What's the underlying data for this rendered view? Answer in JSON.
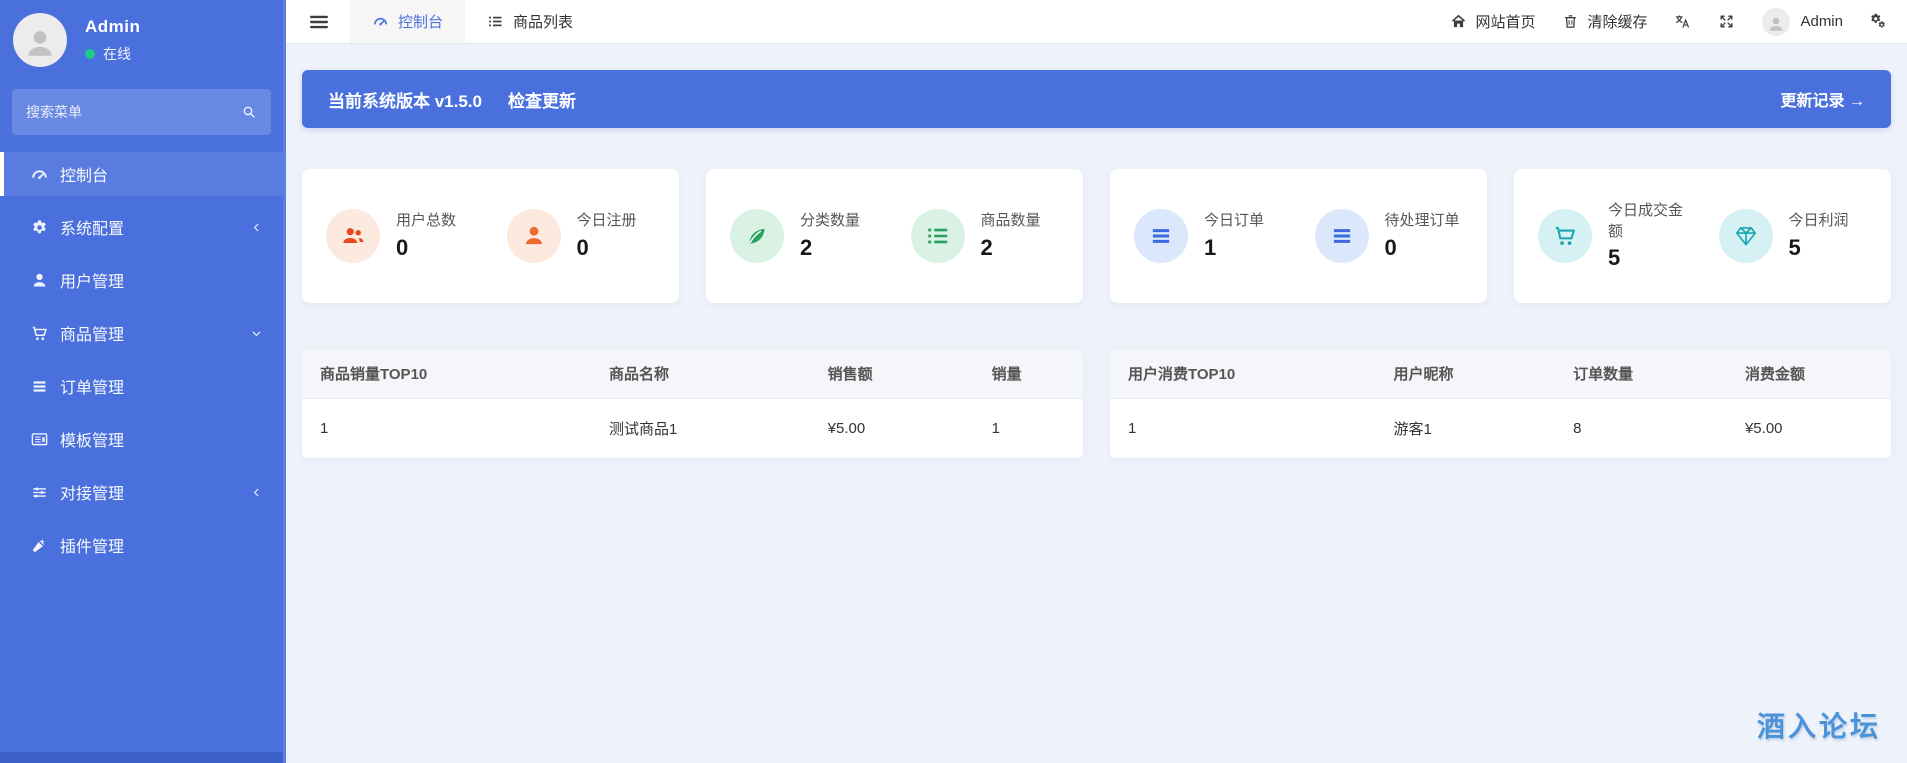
{
  "colors": {
    "accent_blue": "#4a70dd",
    "online_green": "#1ec98b",
    "watermark_blue": "#4b93d8"
  },
  "sidebar": {
    "user_name": "Admin",
    "user_status": "在线",
    "avatar_icon": "person-icon",
    "search_placeholder": "搜索菜单",
    "search_icon": "search-icon",
    "items": [
      {
        "label": "控制台",
        "icon": "gauge-icon",
        "chevron": ""
      },
      {
        "label": "系统配置",
        "icon": "gear-icon",
        "chevron": "chevron-left-icon"
      },
      {
        "label": "用户管理",
        "icon": "user-icon",
        "chevron": ""
      },
      {
        "label": "商品管理",
        "icon": "cart-icon",
        "chevron": "chevron-down-icon"
      },
      {
        "label": "订单管理",
        "icon": "bars-icon",
        "chevron": ""
      },
      {
        "label": "模板管理",
        "icon": "template-icon",
        "chevron": ""
      },
      {
        "label": "对接管理",
        "icon": "sliders-icon",
        "chevron": "chevron-left-icon"
      },
      {
        "label": "插件管理",
        "icon": "plug-icon",
        "chevron": ""
      }
    ]
  },
  "topbar": {
    "menu_icon": "menu-icon",
    "tabs": [
      {
        "label": "控制台",
        "icon": "gauge-icon"
      },
      {
        "label": "商品列表",
        "icon": "list-icon"
      }
    ],
    "home_icon": "home-icon",
    "home_label": "网站首页",
    "trash_icon": "trash-icon",
    "clear_cache_label": "清除缓存",
    "translate_icon": "translate-icon",
    "fullscreen_icon": "fullscreen-icon",
    "avatar_icon": "person-icon",
    "user_name": "Admin",
    "settings_icon": "cogs-icon"
  },
  "banner": {
    "version_text": "当前系统版本 v1.5.0",
    "check_update_label": "检查更新",
    "changelog_label": "更新记录 →"
  },
  "stat_cards": [
    {
      "stats": [
        {
          "icon": "users-icon",
          "label": "用户总数",
          "value": "0",
          "color": "#e8491f",
          "bg": "#fdeade"
        },
        {
          "icon": "user-icon",
          "label": "今日注册",
          "value": "0",
          "color": "#ed6a2f",
          "bg": "#fdeade"
        }
      ]
    },
    {
      "stats": [
        {
          "icon": "leaf-icon",
          "label": "分类数量",
          "value": "2",
          "color": "#2aa25f",
          "bg": "#d9f2e4"
        },
        {
          "icon": "list-icon",
          "label": "商品数量",
          "value": "2",
          "color": "#2aa25f",
          "bg": "#d9f2e4"
        }
      ]
    },
    {
      "stats": [
        {
          "icon": "bars-icon",
          "label": "今日订单",
          "value": "1",
          "color": "#3a6ce0",
          "bg": "#dbe7fb"
        },
        {
          "icon": "bars-icon",
          "label": "待处理订单",
          "value": "0",
          "color": "#3a6ce0",
          "bg": "#dbe7fb"
        }
      ]
    },
    {
      "stats": [
        {
          "icon": "cart-icon",
          "label": "今日成交金额",
          "value": "5",
          "color": "#18a5b2",
          "bg": "#d6f1f3"
        },
        {
          "icon": "gem-icon",
          "label": "今日利润",
          "value": "5",
          "color": "#18a5b2",
          "bg": "#d6f1f3"
        }
      ]
    }
  ],
  "tables": [
    {
      "headers": [
        "商品销量TOP10",
        "商品名称",
        "销售额",
        "销量"
      ],
      "rows": [
        [
          "1",
          "测试商品1",
          "¥5.00",
          "1"
        ]
      ]
    },
    {
      "headers": [
        "用户消费TOP10",
        "用户昵称",
        "订单数量",
        "消费金额"
      ],
      "rows": [
        [
          "1",
          "游客1",
          "8",
          "¥5.00"
        ]
      ]
    }
  ],
  "watermark": "酒入论坛"
}
